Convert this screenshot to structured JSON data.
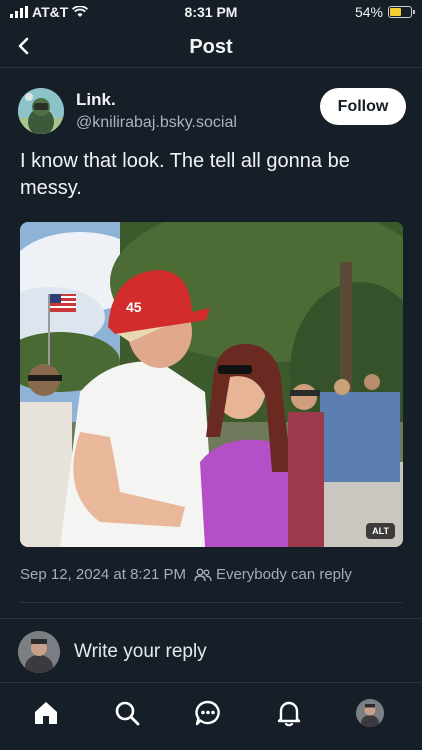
{
  "status_bar": {
    "carrier": "AT&T",
    "time": "8:31 PM",
    "battery": "54%",
    "battery_level": 0.54
  },
  "header": {
    "title": "Post"
  },
  "author": {
    "display_name": "Link.",
    "handle": "@knilirabaj.bsky.social",
    "follow_label": "Follow"
  },
  "post": {
    "text": "I know that look. The tell all gonna be messy.",
    "image_alt_badge": "ALT",
    "image_hat_text": "45",
    "timestamp": "Sep 12, 2024 at 8:21 PM",
    "reply_setting": "Everybody can reply"
  },
  "reply": {
    "placeholder": "Write your reply"
  },
  "tabs": [
    {
      "icon": "home-icon"
    },
    {
      "icon": "search-icon"
    },
    {
      "icon": "chat-icon"
    },
    {
      "icon": "bell-icon"
    },
    {
      "icon": "profile-avatar"
    }
  ],
  "colors": {
    "background": "#161e27",
    "accent": "#ffffff",
    "muted": "#a3aeb9",
    "divider": "#2b3642"
  }
}
